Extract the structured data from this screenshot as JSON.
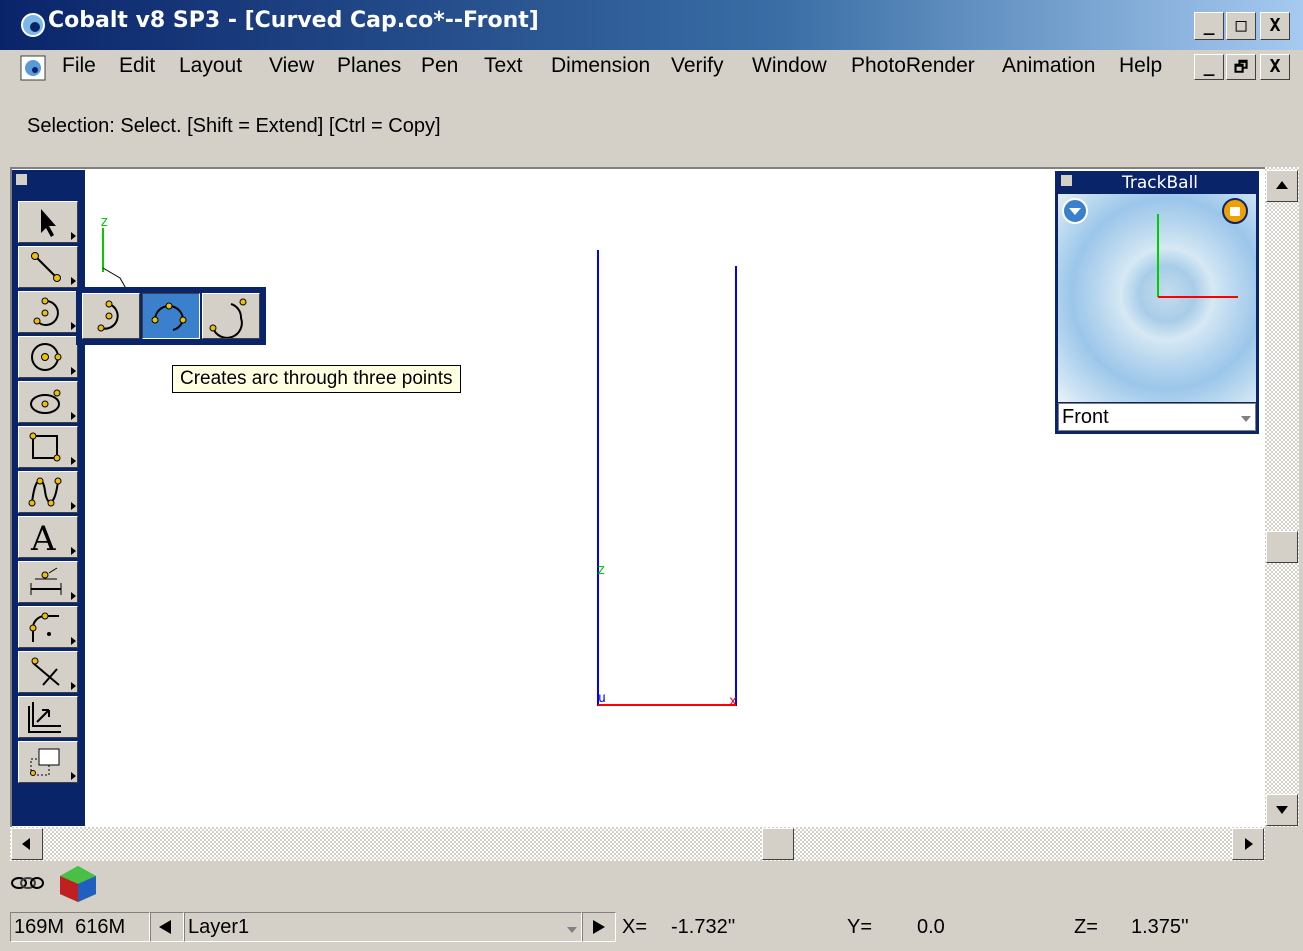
{
  "window": {
    "title": "Cobalt v8 SP3 - [Curved Cap.co*--Front]",
    "caption_buttons": [
      "_",
      "□",
      "X"
    ],
    "mdi_buttons": [
      "_",
      "🗗",
      "X"
    ]
  },
  "menu": {
    "items": [
      "File",
      "Edit",
      "Layout",
      "View",
      "Planes",
      "Pen",
      "Text",
      "Dimension",
      "Verify",
      "Window",
      "PhotoRender",
      "Animation",
      "Help"
    ]
  },
  "prompt": {
    "text": "Selection: Select. [Shift = Extend] [Ctrl = Copy]"
  },
  "toolbar": {
    "tools": [
      "select-arrow-icon",
      "line-icon",
      "arc-icon",
      "circle-icon",
      "ellipse-icon",
      "rectangle-icon",
      "spline-icon",
      "text-icon",
      "dimension-icon",
      "fillet-icon",
      "trim-icon",
      "extend-icon",
      "transform-icon"
    ]
  },
  "flyout": {
    "buttons": [
      "arc-center-icon",
      "arc-three-points-icon",
      "arc-tangent-icon"
    ],
    "active_index": 1,
    "tooltip": "Creates arc through three points"
  },
  "canvas": {
    "axis_labels": {
      "z_top": "z",
      "z_mid": "z",
      "u_origin": "u",
      "x_end": "x"
    }
  },
  "trackball": {
    "title": "TrackBall",
    "view": "Front"
  },
  "status": {
    "memory1": "169M",
    "memory2": "616M",
    "layer": "Layer1",
    "x_label": "X=",
    "x_value": "-1.732''",
    "y_label": "Y=",
    "y_value": "0.0",
    "z_label": "Z=",
    "z_value": "1.375''"
  },
  "colors": {
    "title_start": "#0a246a",
    "title_end": "#a6caf0",
    "axis_x": "#ff0000",
    "axis_y": "#0000ff",
    "axis_z": "#00cc00",
    "tooltip_bg": "#ffffe1"
  }
}
